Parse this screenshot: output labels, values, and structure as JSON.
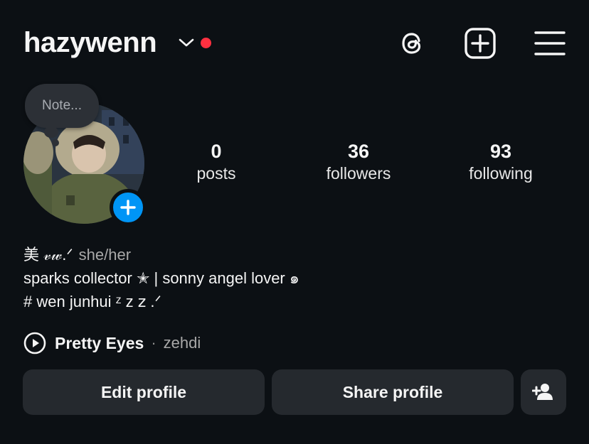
{
  "header": {
    "username": "hazywenn",
    "icons": [
      "chevron-down-icon",
      "threads-icon",
      "create-plus-icon",
      "menu-icon"
    ],
    "live_color": "#ff3040"
  },
  "note": {
    "placeholder": "Note..."
  },
  "stats": {
    "posts": {
      "count": "0",
      "label": "posts"
    },
    "followers": {
      "count": "36",
      "label": "followers"
    },
    "following": {
      "count": "93",
      "label": "following"
    }
  },
  "bio": {
    "name": "美 𝓋𝓌.ᐟ",
    "pronouns": "she/her",
    "line1": "sparks collector ✭ | sonny angel lover ๑",
    "line2": "# wen junhui ᶻ z 𝗓 .ᐟ"
  },
  "music": {
    "song": "Pretty Eyes",
    "separator": "·",
    "artist": "zehdi"
  },
  "buttons": {
    "edit": "Edit profile",
    "share": "Share profile"
  },
  "colors": {
    "background": "#0c1014",
    "button": "#25292e",
    "accent": "#0095f6"
  }
}
